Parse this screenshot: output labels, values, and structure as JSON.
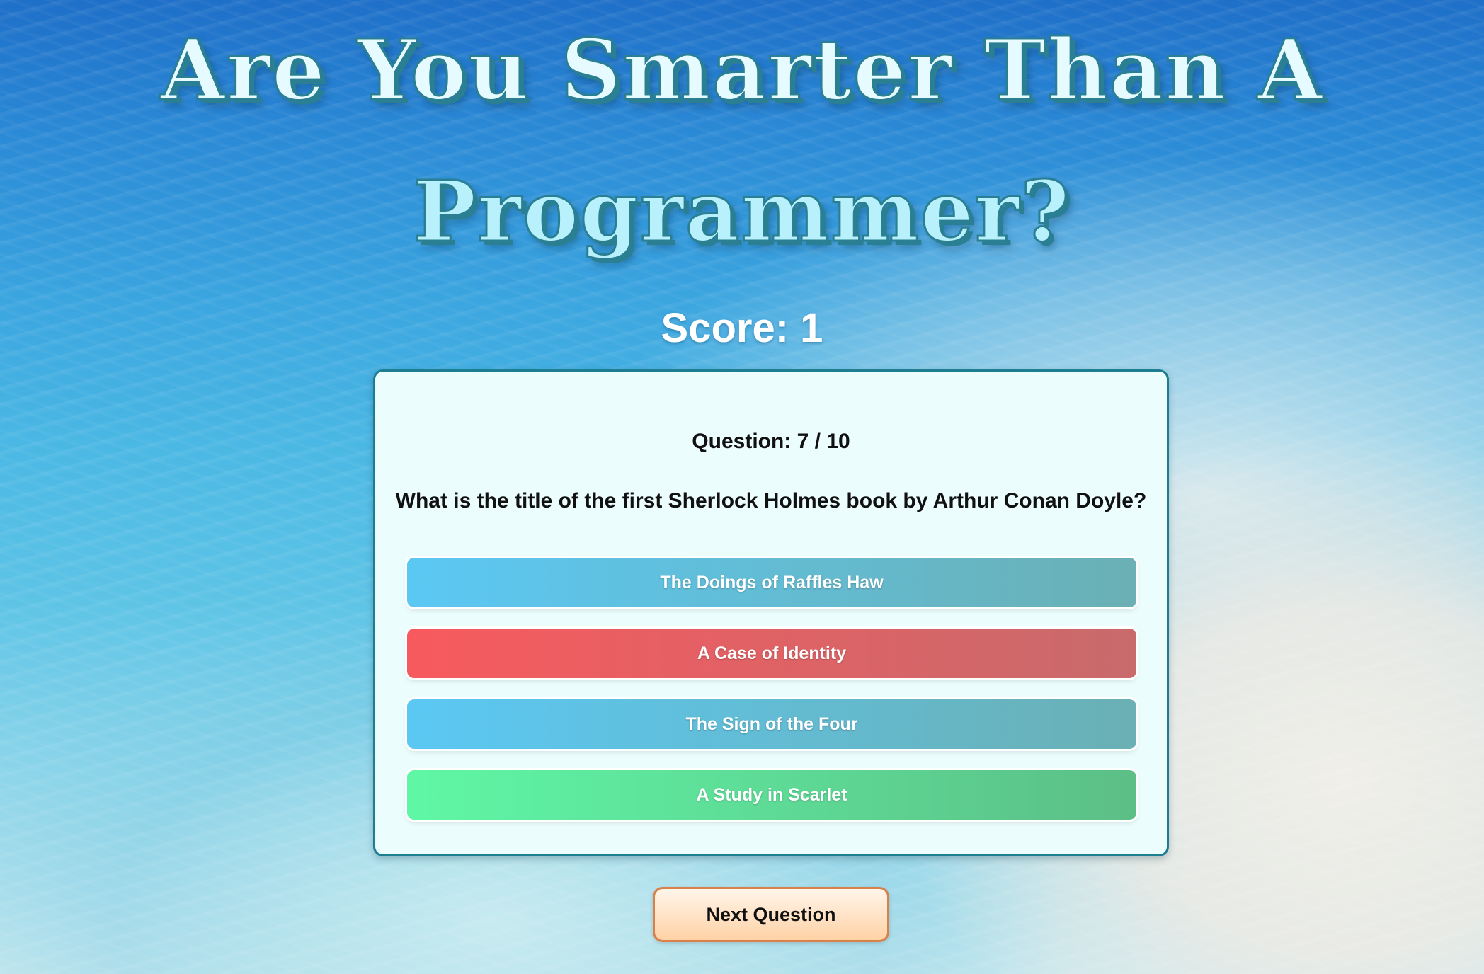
{
  "header": {
    "title_line1": "Are You Smarter Than A",
    "title_line2": "Programmer?"
  },
  "score": {
    "text": "Score: 1"
  },
  "quiz": {
    "question_counter": "Question: 7 / 10",
    "question_text": "What is the title of the first Sherlock Holmes book by Arthur Conan Doyle?",
    "answers": [
      {
        "label": "The Doings of Raffles Haw",
        "state": "neutral"
      },
      {
        "label": "A Case of Identity",
        "state": "wrong"
      },
      {
        "label": "The Sign of the Four",
        "state": "neutral"
      },
      {
        "label": "A Study in Scarlet",
        "state": "correct"
      }
    ]
  },
  "controls": {
    "next_label": "Next Question"
  },
  "colors": {
    "neutral_answer": "#5bc8f4",
    "wrong_answer": "#f75a5e",
    "correct_answer": "#5ff7a6",
    "card_border": "#1d7e92",
    "next_border": "#d9814a"
  }
}
